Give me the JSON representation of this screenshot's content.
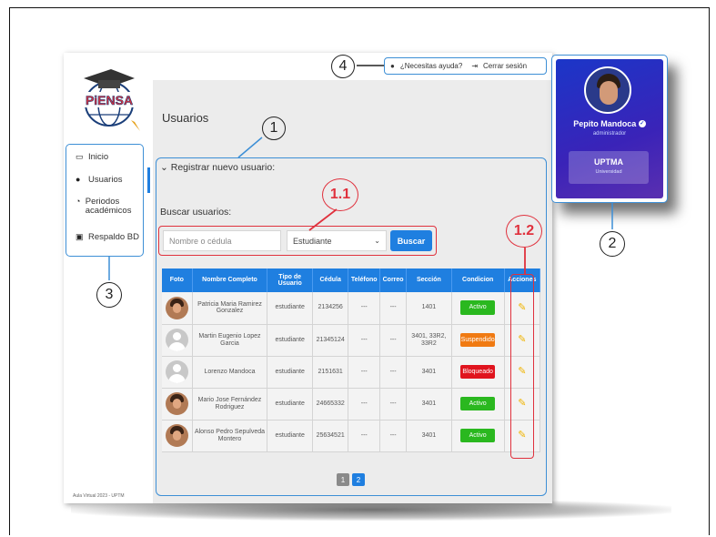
{
  "sidebar": {
    "logo_text": "PiENSA",
    "items": [
      {
        "label": "Inicio",
        "icon": "calendar-icon"
      },
      {
        "label": "Usuarios",
        "icon": "user-icon"
      },
      {
        "label": "Periodos académicos",
        "icon": "clock-icon"
      },
      {
        "label": "Respaldo BD",
        "icon": "database-icon"
      }
    ],
    "footer": "Aula Virtual 2023 - UPTM"
  },
  "header": {
    "help_label": "¿Necesitas ayuda?",
    "logout_label": "Cerrar sesión"
  },
  "main": {
    "title": "Usuarios",
    "register_label": "Registrar nuevo usuario:",
    "search_label": "Buscar usuarios:",
    "search_placeholder": "Nombre o cédula",
    "role_selected": "Estudiante",
    "search_button": "Buscar",
    "columns": [
      "Foto",
      "Nombre Completo",
      "Tipo de Usuario",
      "Cédula",
      "Teléfono",
      "Correo",
      "Sección",
      "Condicion",
      "Acciones"
    ],
    "rows": [
      {
        "photo": "face",
        "name": "Patricia Maria Ramirez Gonzalez",
        "type": "estudiante",
        "cedula": "2134256",
        "telefono": "---",
        "correo": "---",
        "seccion": "1401",
        "condicion": "Activo",
        "condicion_color": "#2ab81f"
      },
      {
        "photo": "generic",
        "name": "Martin Eugenio Lopez Garcia",
        "type": "estudiante",
        "cedula": "21345124",
        "telefono": "---",
        "correo": "---",
        "seccion": "3401, 33R2, 33R2",
        "condicion": "Suspendido",
        "condicion_color": "#f07a12"
      },
      {
        "photo": "generic",
        "name": "Lorenzo Mandoca",
        "type": "estudiante",
        "cedula": "2151631",
        "telefono": "---",
        "correo": "---",
        "seccion": "3401",
        "condicion": "Bloqueado",
        "condicion_color": "#e0141e"
      },
      {
        "photo": "face",
        "name": "Mario Jose Fernández Rodriguez",
        "type": "estudiante",
        "cedula": "24665332",
        "telefono": "---",
        "correo": "---",
        "seccion": "3401",
        "condicion": "Activo",
        "condicion_color": "#2ab81f"
      },
      {
        "photo": "face",
        "name": "Alonso Pedro Sepulveda Montero",
        "type": "estudiante",
        "cedula": "25634521",
        "telefono": "---",
        "correo": "---",
        "seccion": "3401",
        "condicion": "Activo",
        "condicion_color": "#2ab81f"
      }
    ],
    "pages": [
      "1",
      "2"
    ],
    "active_page": "2"
  },
  "profile": {
    "name": "Pepito Mandoca",
    "role": "administrador",
    "org_name": "UPTMA",
    "org_type": "Universidad"
  },
  "callouts": {
    "c1": "1",
    "c11": "1.1",
    "c12": "1.2",
    "c2": "2",
    "c3": "3",
    "c4": "4"
  },
  "colors": {
    "accent": "#1f7fe0",
    "callout_red": "#e0313d",
    "outline_blue": "#3d8fd6"
  }
}
